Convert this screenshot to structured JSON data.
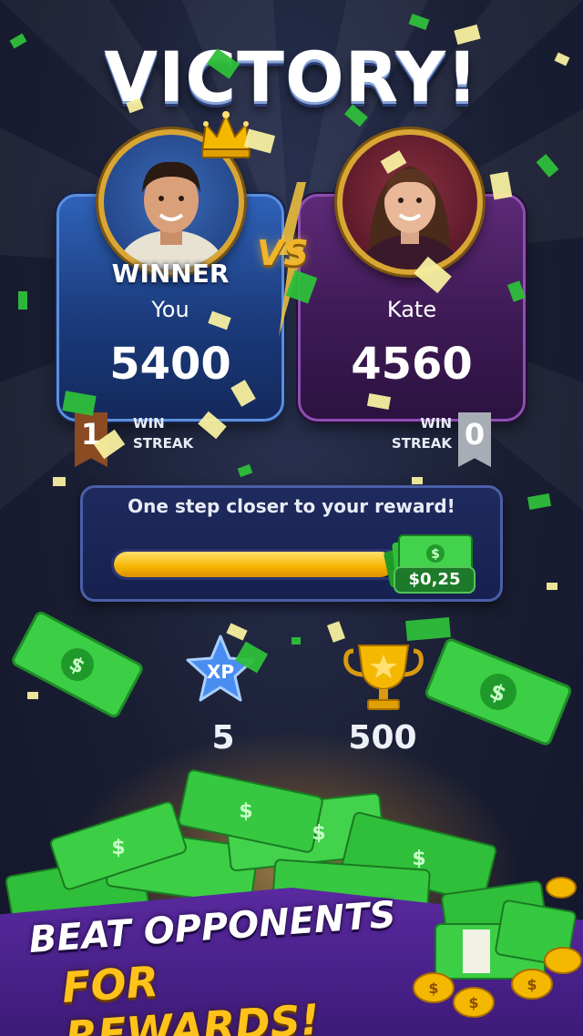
{
  "screen": {
    "title": "VICTORY!",
    "vs_label": "VS"
  },
  "player": {
    "badge": "WINNER",
    "name": "You",
    "score": "5400",
    "streak_value": "1",
    "streak_label_1": "WIN",
    "streak_label_2": "STREAK"
  },
  "opponent": {
    "name": "Kate",
    "score": "4560",
    "streak_value": "0",
    "streak_label_1": "WIN",
    "streak_label_2": "STREAK"
  },
  "reward": {
    "message": "One step closer to your reward!",
    "progress": 0.8,
    "amount": "$0,25"
  },
  "stats": {
    "xp_icon_text": "XP",
    "xp_value": "5",
    "trophy_value": "500"
  },
  "banner": {
    "line1": "BEAT OPPONENTS",
    "line2": "FOR REWARDS!"
  },
  "colors": {
    "player_card": "#1b3b7c",
    "opponent_card": "#3e1a55",
    "accent_gold": "#f5b400",
    "cash_green": "#2fbf3a",
    "banner_purple": "#4a2290"
  },
  "icons": [
    "crown-icon",
    "vs-lightning-icon",
    "xp-star-icon",
    "trophy-icon",
    "cash-stack-icon",
    "coin-icon"
  ]
}
